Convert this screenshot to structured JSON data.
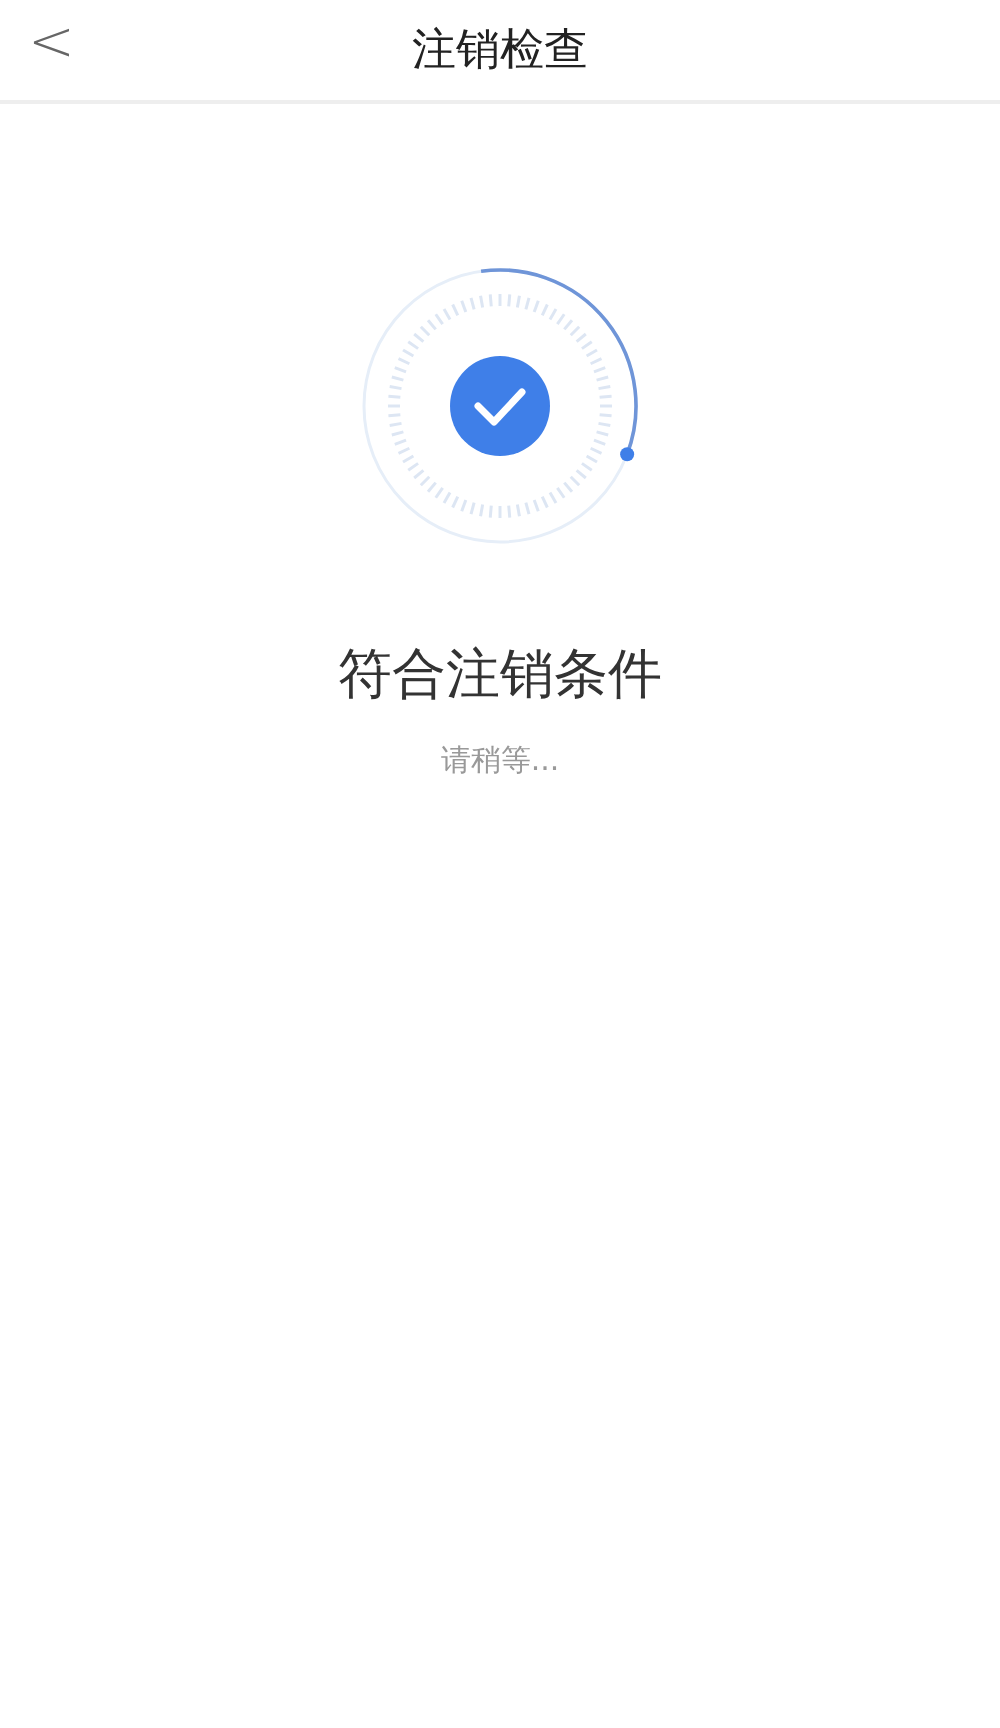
{
  "header": {
    "back": "<",
    "title": "注销检查"
  },
  "check": {
    "done": true
  },
  "status": {
    "title": "符合注销条件",
    "subtitle": "请稍等..."
  }
}
